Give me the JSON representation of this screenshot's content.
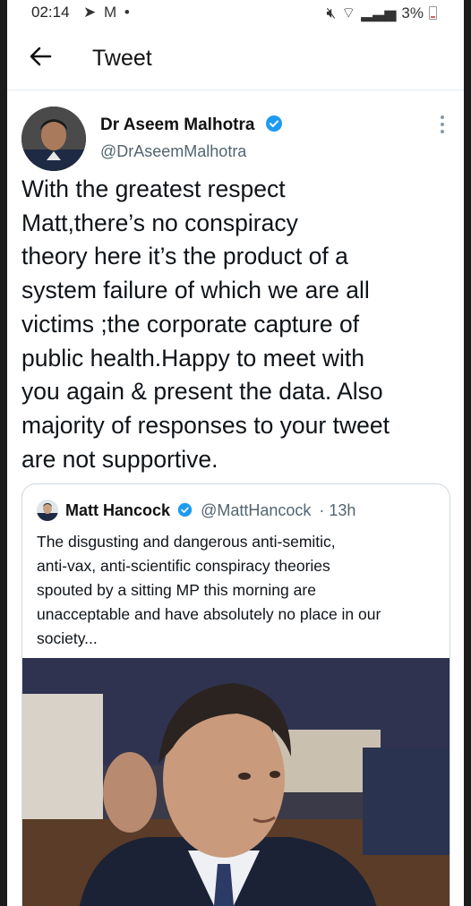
{
  "status_bar": {
    "time": "02:14",
    "battery": "3%"
  },
  "header": {
    "title": "Tweet"
  },
  "tweet": {
    "author_name": "Dr Aseem Malhotra",
    "author_handle": "@DrAseemMalhotra",
    "lines": [
      "With the greatest respect",
      "Matt,there’s no conspiracy",
      "theory here it’s the product of a",
      "system failure of which we are all",
      "victims ;the corporate capture of",
      "public health.Happy to meet with",
      "you again & present the data. Also",
      "majority of responses to your tweet",
      "are not supportive."
    ]
  },
  "quoted_tweet": {
    "author_name": "Matt Hancock",
    "author_handle": "@MattHancock",
    "time": "· 13h",
    "lines": [
      "The disgusting and dangerous anti-semitic,",
      "anti-vax, anti-scientific conspiracy theories",
      "spouted by a sitting MP this morning are",
      "unacceptable and have absolutely no place in our",
      "society..."
    ]
  },
  "colors": {
    "verified": "#1d9bf0",
    "text": "#0f1419",
    "secondary": "#536471",
    "border": "#cfd9de"
  }
}
